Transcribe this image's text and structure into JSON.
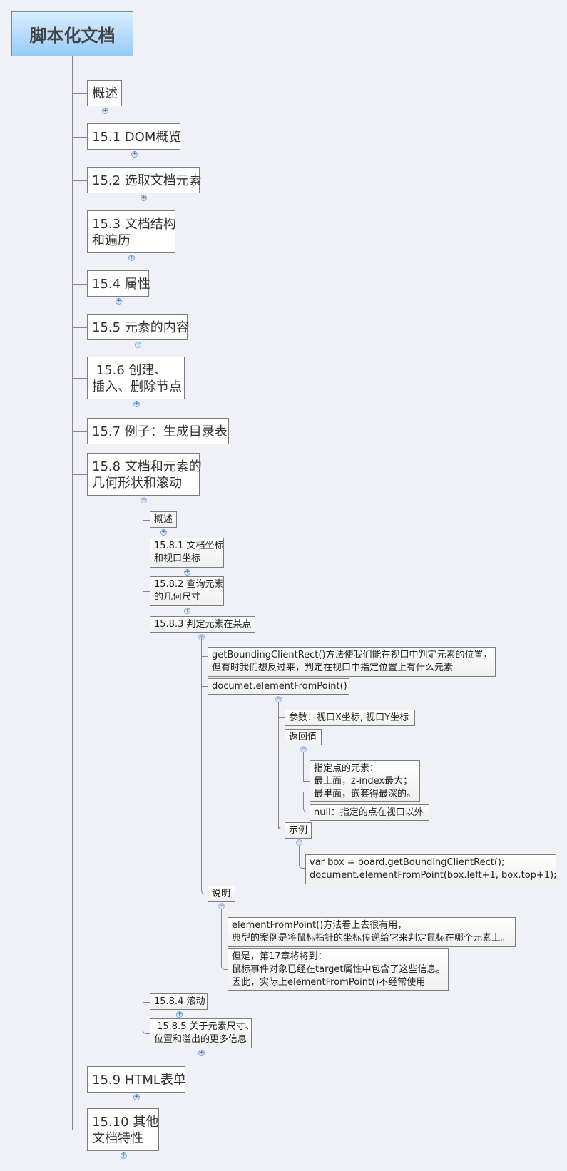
{
  "root": {
    "label": "脚本化文档"
  },
  "topics": [
    {
      "label": "概述",
      "toggle": "+"
    },
    {
      "label": "15.1 DOM概览",
      "toggle": "+"
    },
    {
      "label": "15.2 选取文档元素",
      "toggle": "+"
    },
    {
      "label": "15.3 文档结构\n和遍历",
      "toggle": "+"
    },
    {
      "label": "15.4 属性",
      "toggle": "+"
    },
    {
      "label": "15.5 元素的内容",
      "toggle": "+"
    },
    {
      "label": " 15.6 创建、\n插入、删除节点",
      "toggle": "+"
    },
    {
      "label": "15.7 例子：生成目录表",
      "toggle": ""
    },
    {
      "label": "15.8 文档和元素的\n几何形状和滚动",
      "toggle": "−"
    },
    {
      "label": "15.9 HTML表单",
      "toggle": "+"
    },
    {
      "label": "15.10 其他\n文档特性",
      "toggle": "+"
    }
  ],
  "sub_15_8": [
    {
      "label": "概述",
      "toggle": "+"
    },
    {
      "label": "15.8.1 文档坐标\n和视口坐标",
      "toggle": "+"
    },
    {
      "label": "15.8.2 查询元素\n的几何尺寸",
      "toggle": "+"
    },
    {
      "label": "15.8.3 判定元素在某点",
      "toggle": "−"
    },
    {
      "label": "15.8.4 滚动",
      "toggle": "+"
    },
    {
      "label": " 15.8.5 关于元素尺寸、\n位置和溢出的更多信息",
      "toggle": "+"
    }
  ],
  "sub_15_8_3": {
    "intro": "getBoundingClientRect()方法使我们能在视口中判定元素的位置，\n但有时我们想反过来，判定在视口中指定位置上有什么元素",
    "method": "documet.elementFromPoint()",
    "params": "参数：视口X坐标, 视口Y坐标",
    "returns": "返回值",
    "return_element": "指定点的元素：\n最上面，z-index最大；\n最里面，嵌套得最深的。",
    "return_null": "null：指定的点在视口以外",
    "example": "示例",
    "example_code": "var box = board.getBoundingClientRect();\ndocument.elementFromPoint(box.left+1, box.top+1);",
    "notes": "说明",
    "note_1": "elementFromPoint()方法看上去很有用，\n典型的案例是将鼠标指针的坐标传递给它来判定鼠标在哪个元素上。",
    "note_2": "但是，第17章将将到：\n鼠标事件对象已经在target属性中包含了这些信息。\n因此，实际上elementFromPoint()不经常使用"
  },
  "colors": {
    "background": "#eff1f7",
    "root_top": "#d9eeff",
    "root_bottom": "#98cbf7",
    "line": "#868686",
    "toggle": "#7ea7d4"
  }
}
